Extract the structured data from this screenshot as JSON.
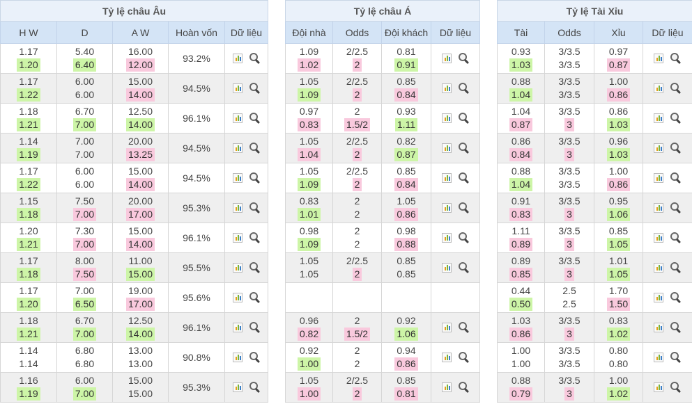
{
  "panels": {
    "eu": {
      "title": "Tỷ lệ châu Âu",
      "headers": [
        "H W",
        "D",
        "A W",
        "Hoàn vốn",
        "Dữ liệu"
      ]
    },
    "as": {
      "title": "Tỷ lệ châu Á",
      "headers": [
        "Đội nhà",
        "Odds",
        "Đội khách",
        "Dữ liệu"
      ]
    },
    "ou": {
      "title": "Tỷ lệ Tài Xỉu",
      "headers": [
        "Tài",
        "Odds",
        "Xỉu",
        "Dữ liệu"
      ]
    }
  },
  "rows": [
    {
      "eu": {
        "hw": [
          "1.17",
          "1.20",
          "up"
        ],
        "d": [
          "5.40",
          "6.40",
          "up"
        ],
        "aw": [
          "16.00",
          "12.00",
          "down"
        ],
        "ret": "93.2%"
      },
      "as": {
        "home": [
          "1.09",
          "1.02",
          "down"
        ],
        "odds": [
          "2/2.5",
          "2",
          "down"
        ],
        "away": [
          "0.81",
          "0.91",
          "up"
        ]
      },
      "ou": {
        "over": [
          "0.93",
          "1.03",
          "up"
        ],
        "odds": [
          "3/3.5",
          "3/3.5",
          ""
        ],
        "under": [
          "0.97",
          "0.87",
          "down"
        ]
      }
    },
    {
      "eu": {
        "hw": [
          "1.17",
          "1.22",
          "up"
        ],
        "d": [
          "6.00",
          "6.00",
          ""
        ],
        "aw": [
          "15.00",
          "14.00",
          "down"
        ],
        "ret": "94.5%"
      },
      "as": {
        "home": [
          "1.05",
          "1.09",
          "up"
        ],
        "odds": [
          "2/2.5",
          "2",
          "down"
        ],
        "away": [
          "0.85",
          "0.84",
          "down"
        ]
      },
      "ou": {
        "over": [
          "0.88",
          "1.04",
          "up"
        ],
        "odds": [
          "3/3.5",
          "3/3.5",
          ""
        ],
        "under": [
          "1.00",
          "0.86",
          "down"
        ]
      }
    },
    {
      "eu": {
        "hw": [
          "1.18",
          "1.21",
          "up"
        ],
        "d": [
          "6.70",
          "7.00",
          "up"
        ],
        "aw": [
          "12.50",
          "14.00",
          "up"
        ],
        "ret": "96.1%"
      },
      "as": {
        "home": [
          "0.97",
          "0.83",
          "down"
        ],
        "odds": [
          "2",
          "1.5/2",
          "down"
        ],
        "away": [
          "0.93",
          "1.11",
          "up"
        ]
      },
      "ou": {
        "over": [
          "1.04",
          "0.87",
          "down"
        ],
        "odds": [
          "3/3.5",
          "3",
          "down"
        ],
        "under": [
          "0.86",
          "1.03",
          "up"
        ]
      }
    },
    {
      "eu": {
        "hw": [
          "1.14",
          "1.19",
          "up"
        ],
        "d": [
          "7.00",
          "7.00",
          ""
        ],
        "aw": [
          "20.00",
          "13.25",
          "down"
        ],
        "ret": "94.5%"
      },
      "as": {
        "home": [
          "1.05",
          "1.04",
          "down"
        ],
        "odds": [
          "2/2.5",
          "2",
          "down"
        ],
        "away": [
          "0.82",
          "0.87",
          "up"
        ]
      },
      "ou": {
        "over": [
          "0.86",
          "0.84",
          "down"
        ],
        "odds": [
          "3/3.5",
          "3",
          "down"
        ],
        "under": [
          "0.96",
          "1.03",
          "up"
        ]
      }
    },
    {
      "eu": {
        "hw": [
          "1.17",
          "1.22",
          "up"
        ],
        "d": [
          "6.00",
          "6.00",
          ""
        ],
        "aw": [
          "15.00",
          "14.00",
          "down"
        ],
        "ret": "94.5%"
      },
      "as": {
        "home": [
          "1.05",
          "1.09",
          "up"
        ],
        "odds": [
          "2/2.5",
          "2",
          "down"
        ],
        "away": [
          "0.85",
          "0.84",
          "down"
        ]
      },
      "ou": {
        "over": [
          "0.88",
          "1.04",
          "up"
        ],
        "odds": [
          "3/3.5",
          "3/3.5",
          ""
        ],
        "under": [
          "1.00",
          "0.86",
          "down"
        ]
      }
    },
    {
      "eu": {
        "hw": [
          "1.15",
          "1.18",
          "up"
        ],
        "d": [
          "7.50",
          "7.00",
          "down"
        ],
        "aw": [
          "20.00",
          "17.00",
          "down"
        ],
        "ret": "95.3%"
      },
      "as": {
        "home": [
          "0.83",
          "1.01",
          "up"
        ],
        "odds": [
          "2",
          "2",
          ""
        ],
        "away": [
          "1.05",
          "0.86",
          "down"
        ]
      },
      "ou": {
        "over": [
          "0.91",
          "0.83",
          "down"
        ],
        "odds": [
          "3/3.5",
          "3",
          "down"
        ],
        "under": [
          "0.95",
          "1.06",
          "up"
        ]
      }
    },
    {
      "eu": {
        "hw": [
          "1.20",
          "1.21",
          "up"
        ],
        "d": [
          "7.30",
          "7.00",
          "down"
        ],
        "aw": [
          "15.00",
          "14.00",
          "down"
        ],
        "ret": "96.1%"
      },
      "as": {
        "home": [
          "0.98",
          "1.09",
          "up"
        ],
        "odds": [
          "2",
          "2",
          ""
        ],
        "away": [
          "0.98",
          "0.88",
          "down"
        ]
      },
      "ou": {
        "over": [
          "1.11",
          "0.89",
          "down"
        ],
        "odds": [
          "3/3.5",
          "3",
          "down"
        ],
        "under": [
          "0.85",
          "1.05",
          "up"
        ]
      }
    },
    {
      "eu": {
        "hw": [
          "1.17",
          "1.18",
          "up"
        ],
        "d": [
          "8.00",
          "7.50",
          "down"
        ],
        "aw": [
          "11.00",
          "15.00",
          "up"
        ],
        "ret": "95.5%"
      },
      "as": {
        "home": [
          "1.05",
          "1.05",
          ""
        ],
        "odds": [
          "2/2.5",
          "2",
          "down"
        ],
        "away": [
          "0.85",
          "0.85",
          ""
        ]
      },
      "ou": {
        "over": [
          "0.89",
          "0.85",
          "down"
        ],
        "odds": [
          "3/3.5",
          "3",
          "down"
        ],
        "under": [
          "1.01",
          "1.05",
          "up"
        ]
      }
    },
    {
      "eu": {
        "hw": [
          "1.17",
          "1.20",
          "up"
        ],
        "d": [
          "7.00",
          "6.50",
          "up"
        ],
        "aw": [
          "19.00",
          "17.00",
          "down"
        ],
        "ret": "95.6%"
      },
      "as": null,
      "ou": {
        "over": [
          "0.44",
          "0.50",
          "up"
        ],
        "odds": [
          "2.5",
          "2.5",
          ""
        ],
        "under": [
          "1.70",
          "1.50",
          "down"
        ]
      }
    },
    {
      "eu": {
        "hw": [
          "1.18",
          "1.21",
          "up"
        ],
        "d": [
          "6.70",
          "7.00",
          "up"
        ],
        "aw": [
          "12.50",
          "14.00",
          "up"
        ],
        "ret": "96.1%"
      },
      "as": {
        "home": [
          "0.96",
          "0.82",
          "down"
        ],
        "odds": [
          "2",
          "1.5/2",
          "down"
        ],
        "away": [
          "0.92",
          "1.06",
          "up"
        ]
      },
      "ou": {
        "over": [
          "1.03",
          "0.86",
          "down"
        ],
        "odds": [
          "3/3.5",
          "3",
          "down"
        ],
        "under": [
          "0.83",
          "1.02",
          "up"
        ]
      }
    },
    {
      "eu": {
        "hw": [
          "1.14",
          "1.14",
          ""
        ],
        "d": [
          "6.80",
          "6.80",
          ""
        ],
        "aw": [
          "13.00",
          "13.00",
          ""
        ],
        "ret": "90.8%"
      },
      "as": {
        "home": [
          "0.92",
          "1.00",
          "up"
        ],
        "odds": [
          "2",
          "2",
          ""
        ],
        "away": [
          "0.94",
          "0.86",
          "down"
        ]
      },
      "ou": {
        "over": [
          "1.00",
          "1.00",
          ""
        ],
        "odds": [
          "3/3.5",
          "3/3.5",
          ""
        ],
        "under": [
          "0.80",
          "0.80",
          ""
        ]
      }
    },
    {
      "eu": {
        "hw": [
          "1.16",
          "1.19",
          "up"
        ],
        "d": [
          "6.00",
          "7.00",
          "up"
        ],
        "aw": [
          "15.00",
          "15.00",
          ""
        ],
        "ret": "95.3%"
      },
      "as": {
        "home": [
          "1.05",
          "1.00",
          "down"
        ],
        "odds": [
          "2/2.5",
          "2",
          "down"
        ],
        "away": [
          "0.85",
          "0.81",
          "down"
        ]
      },
      "ou": {
        "over": [
          "0.88",
          "0.79",
          "down"
        ],
        "odds": [
          "3/3.5",
          "3",
          "down"
        ],
        "under": [
          "1.00",
          "1.02",
          "up"
        ]
      }
    }
  ],
  "icons": {
    "chart": "bar-chart-icon",
    "search": "magnifier-icon"
  }
}
